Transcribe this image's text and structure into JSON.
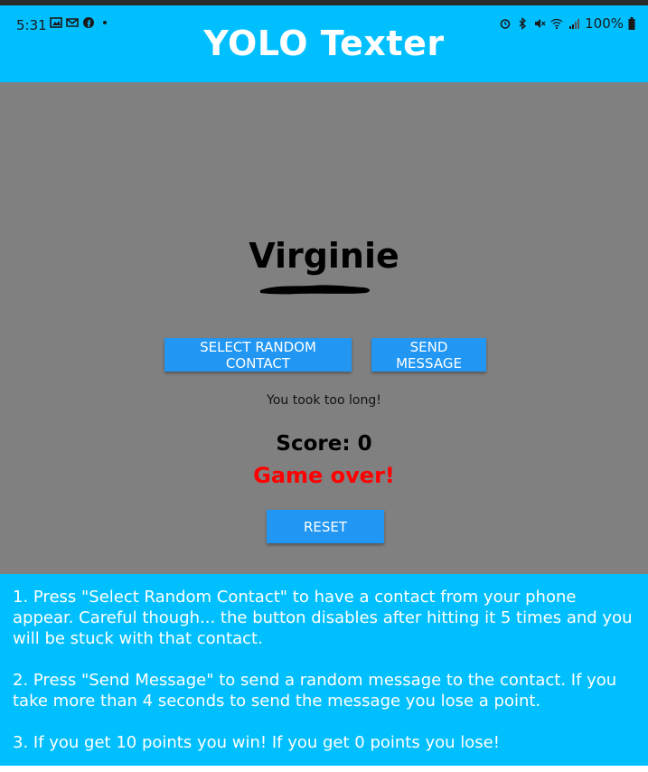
{
  "status_bar": {
    "time": "5:31",
    "battery": "100%",
    "left_icons": [
      "image-icon",
      "mail-icon",
      "facebook-icon",
      "dot-icon"
    ],
    "right_icons": [
      "alarm-icon",
      "bluetooth-icon",
      "mute-icon",
      "wifi-icon",
      "signal-icon",
      "battery-icon"
    ]
  },
  "app": {
    "title": "YOLO Texter",
    "accent_color": "#00bfff",
    "button_color": "#2196f3"
  },
  "game": {
    "contact_name": "Virginie",
    "select_button": "SELECT RANDOM CONTACT",
    "send_button": "SEND MESSAGE",
    "status_message": "You took too long!",
    "score_text": "Score: 0",
    "game_over_text": "Game over!",
    "game_over_color": "#ff0000",
    "reset_button": "RESET"
  },
  "instructions": {
    "step1": "1. Press \"Select Random Contact\" to have a contact from your phone appear. Careful though... the button disables after hitting it 5 times and you will be stuck with that contact.",
    "step2": "2. Press \"Send Message\" to send a random message to the contact. If you take more than 4 seconds to send the message you lose a point.",
    "step3": "3. If you get 10 points you win! If you get 0 points you lose!"
  }
}
